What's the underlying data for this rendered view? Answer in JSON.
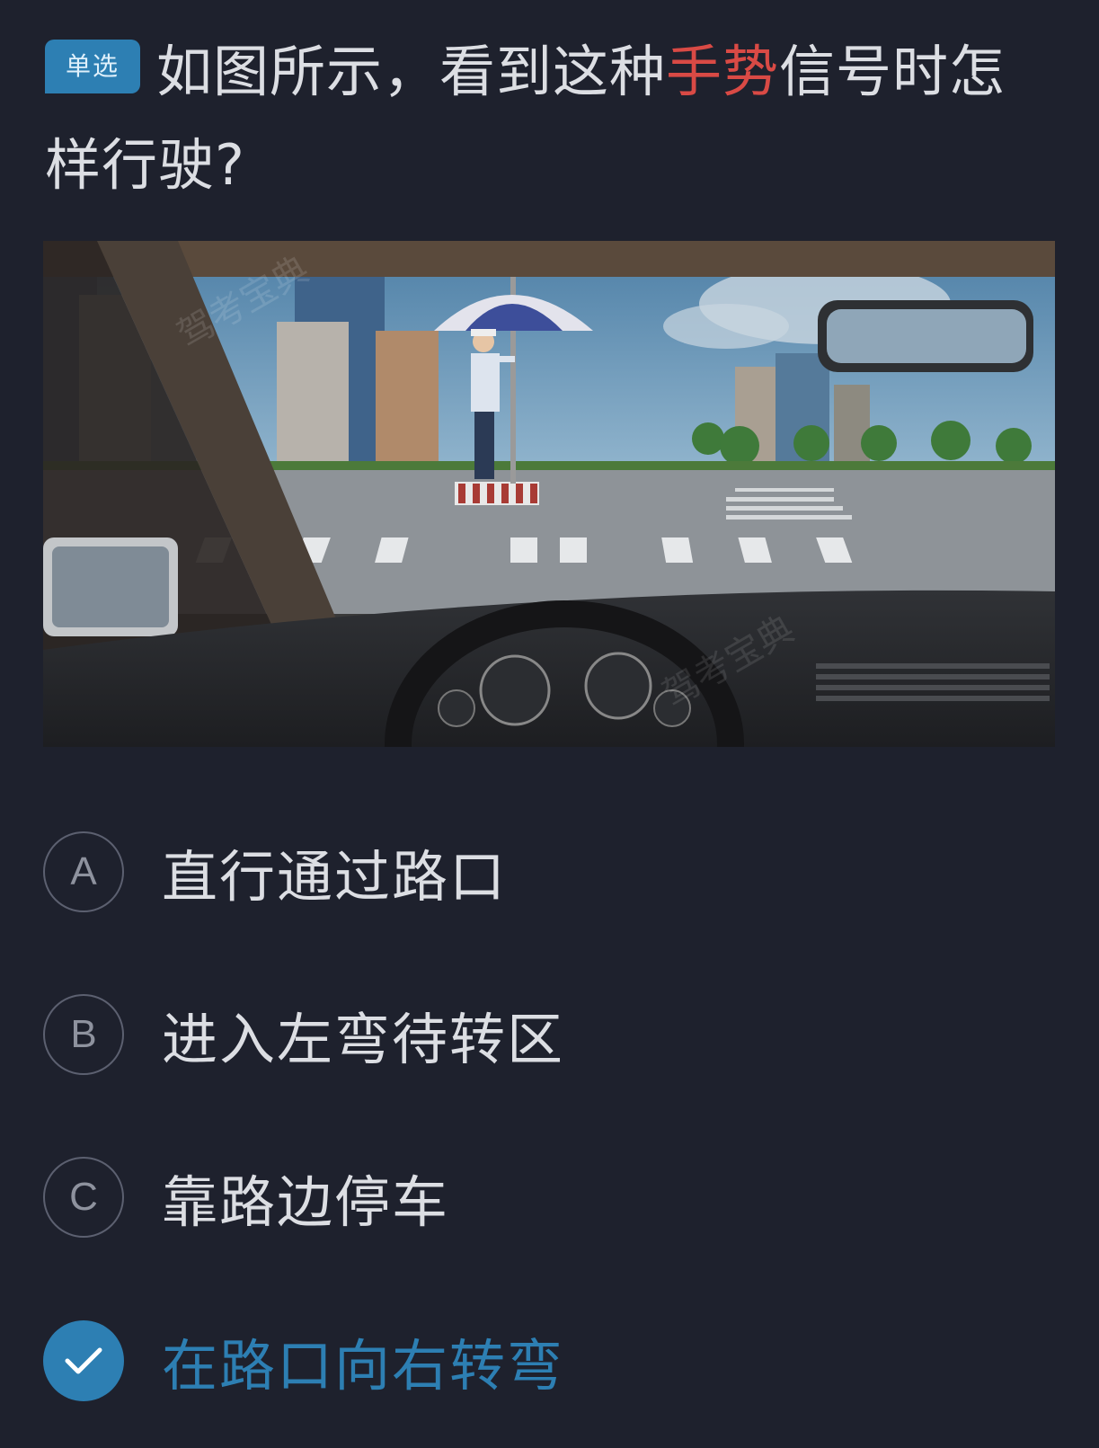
{
  "question": {
    "tag": "单选",
    "text_before": "如图所示，看到这种",
    "text_highlight": "手势",
    "text_after": "信号时怎样行驶?"
  },
  "image": {
    "description_icon": "traffic-police-hand-signal-scene",
    "watermark": "驾考宝典"
  },
  "options": [
    {
      "letter": "A",
      "text": "直行通过路口",
      "selected": false
    },
    {
      "letter": "B",
      "text": "进入左弯待转区",
      "selected": false
    },
    {
      "letter": "C",
      "text": "靠路边停车",
      "selected": false
    },
    {
      "letter": "",
      "text": "在路口向右转弯",
      "selected": true
    }
  ],
  "colors": {
    "background": "#1e212d",
    "accent": "#2d7fb3",
    "highlight": "#d94a45"
  }
}
